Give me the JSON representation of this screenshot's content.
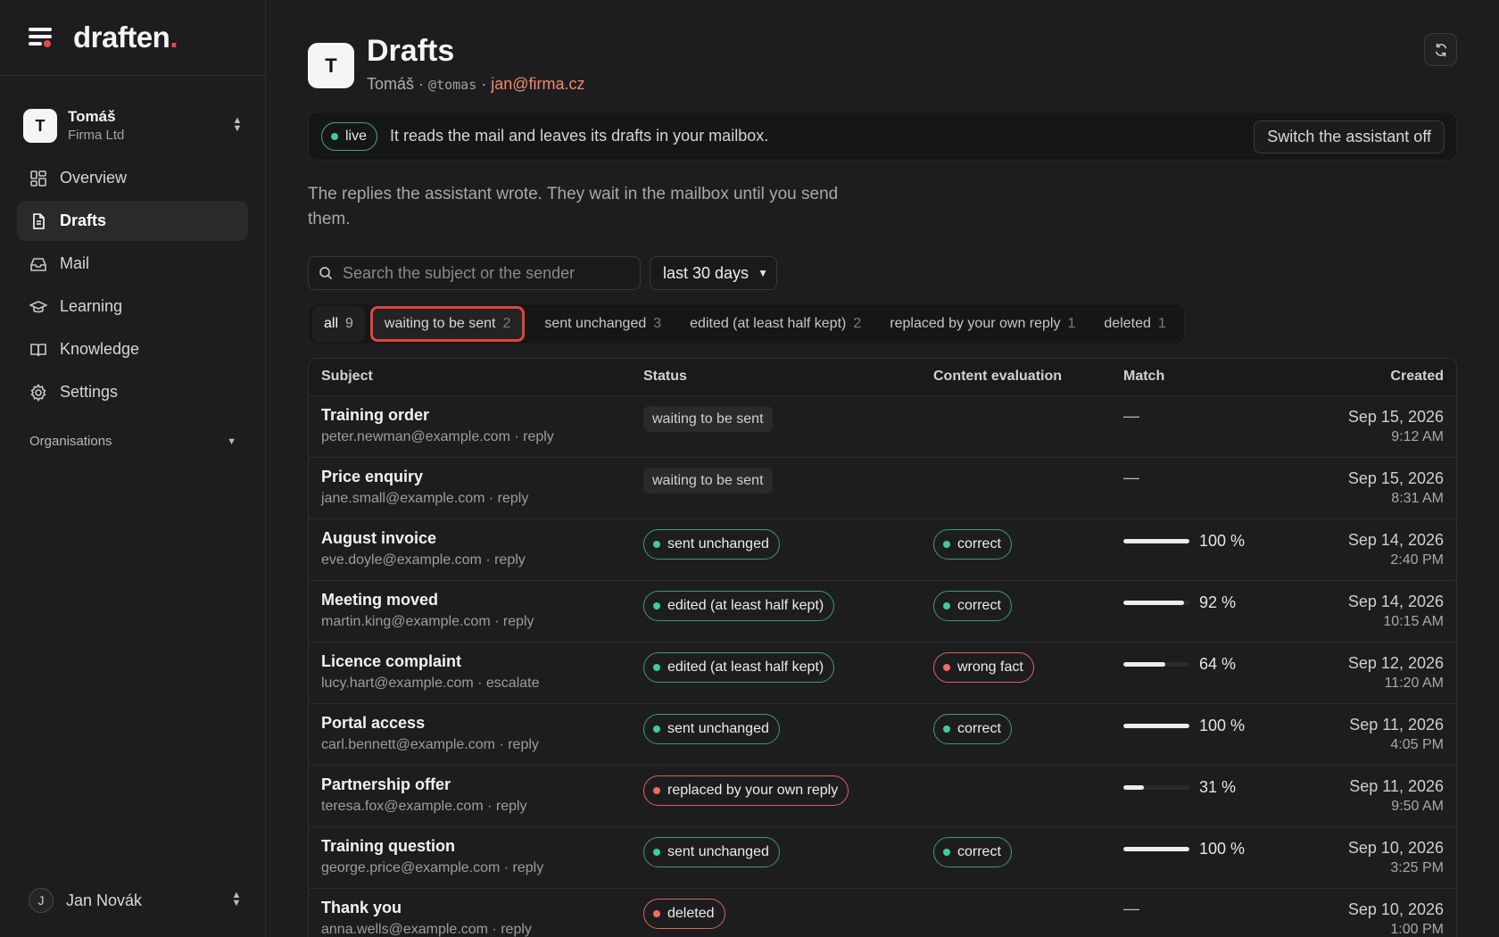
{
  "brand": {
    "name": "draften",
    "accent": "."
  },
  "workspace": {
    "avatar": "T",
    "name": "Tomáš",
    "org": "Firma Ltd"
  },
  "nav": [
    {
      "label": "Overview",
      "icon": "grid-icon",
      "active": false
    },
    {
      "label": "Drafts",
      "icon": "document-icon",
      "active": true
    },
    {
      "label": "Mail",
      "icon": "inbox-icon",
      "active": false
    },
    {
      "label": "Learning",
      "icon": "graduation-cap-icon",
      "active": false
    },
    {
      "label": "Knowledge",
      "icon": "book-icon",
      "active": false
    },
    {
      "label": "Settings",
      "icon": "gear-icon",
      "active": false
    }
  ],
  "organisations_label": "Organisations",
  "user": {
    "avatar": "J",
    "name": "Jan Novák"
  },
  "header": {
    "avatar": "T",
    "title": "Drafts",
    "name": "Tomáš",
    "sep": "·",
    "handle": "@tomas",
    "email": "jan@firma.cz"
  },
  "banner": {
    "pill": "live",
    "text": "It reads the mail and leaves its drafts in your mailbox.",
    "button": "Switch the assistant off"
  },
  "intro": "The replies the assistant wrote. They wait in the mailbox until you send them.",
  "search": {
    "placeholder": "Search the subject or the sender",
    "value": ""
  },
  "range": {
    "selected": "last 30 days"
  },
  "tabs": [
    {
      "label": "all",
      "count": "9"
    },
    {
      "label": "waiting to be sent",
      "count": "2"
    },
    {
      "label": "sent unchanged",
      "count": "3"
    },
    {
      "label": "edited (at least half kept)",
      "count": "2"
    },
    {
      "label": "replaced by your own reply",
      "count": "1"
    },
    {
      "label": "deleted",
      "count": "1"
    }
  ],
  "columns": {
    "subject": "Subject",
    "status": "Status",
    "evaluation": "Content evaluation",
    "match": "Match",
    "created": "Created"
  },
  "rows": [
    {
      "subject": "Training order",
      "meta": "peter.newman@example.com · reply",
      "status": "waiting to be sent",
      "status_kind": "plain",
      "eval": "",
      "eval_kind": "",
      "match": null,
      "match_text": "—",
      "date": "Sep 15, 2026",
      "time": "9:12 AM"
    },
    {
      "subject": "Price enquiry",
      "meta": "jane.small@example.com · reply",
      "status": "waiting to be sent",
      "status_kind": "plain",
      "eval": "",
      "eval_kind": "",
      "match": null,
      "match_text": "—",
      "date": "Sep 15, 2026",
      "time": "8:31 AM"
    },
    {
      "subject": "August invoice",
      "meta": "eve.doyle@example.com · reply",
      "status": "sent unchanged",
      "status_kind": "green",
      "eval": "correct",
      "eval_kind": "green",
      "match": 100,
      "match_text": "100 %",
      "date": "Sep 14, 2026",
      "time": "2:40 PM"
    },
    {
      "subject": "Meeting moved",
      "meta": "martin.king@example.com · reply",
      "status": "edited (at least half kept)",
      "status_kind": "green",
      "eval": "correct",
      "eval_kind": "green",
      "match": 92,
      "match_text": "92 %",
      "date": "Sep 14, 2026",
      "time": "10:15 AM"
    },
    {
      "subject": "Licence complaint",
      "meta": "lucy.hart@example.com · escalate",
      "status": "edited (at least half kept)",
      "status_kind": "green",
      "eval": "wrong fact",
      "eval_kind": "red",
      "match": 64,
      "match_text": "64 %",
      "date": "Sep 12, 2026",
      "time": "11:20 AM"
    },
    {
      "subject": "Portal access",
      "meta": "carl.bennett@example.com · reply",
      "status": "sent unchanged",
      "status_kind": "green",
      "eval": "correct",
      "eval_kind": "green",
      "match": 100,
      "match_text": "100 %",
      "date": "Sep 11, 2026",
      "time": "4:05 PM"
    },
    {
      "subject": "Partnership offer",
      "meta": "teresa.fox@example.com · reply",
      "status": "replaced by your own reply",
      "status_kind": "red",
      "eval": "",
      "eval_kind": "",
      "match": 31,
      "match_text": "31 %",
      "date": "Sep 11, 2026",
      "time": "9:50 AM"
    },
    {
      "subject": "Training question",
      "meta": "george.price@example.com · reply",
      "status": "sent unchanged",
      "status_kind": "green",
      "eval": "correct",
      "eval_kind": "green",
      "match": 100,
      "match_text": "100 %",
      "date": "Sep 10, 2026",
      "time": "3:25 PM"
    },
    {
      "subject": "Thank you",
      "meta": "anna.wells@example.com · reply",
      "status": "deleted",
      "status_kind": "red",
      "eval": "",
      "eval_kind": "",
      "match": null,
      "match_text": "—",
      "date": "Sep 10, 2026",
      "time": "1:00 PM"
    }
  ],
  "colors": {
    "accent": "#e5484d",
    "email": "#f08a6e",
    "green": "#3ecf8e",
    "red": "#f06b5e",
    "selected_outline": "#e0453a"
  }
}
